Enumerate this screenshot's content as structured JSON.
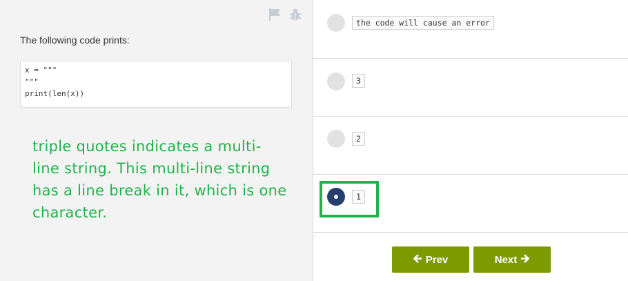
{
  "header": {
    "flag_icon": "flag-icon",
    "bug_icon": "bug-icon"
  },
  "question": {
    "prompt": "The following code prints:",
    "code_lines": [
      "x = \"\"\"",
      "\"\"\"",
      "print(len(x))"
    ]
  },
  "annotation": {
    "text": "triple quotes indicates a multi-line string. This multi-line string has a line break in it, which is one character.",
    "color": "#1fb34a"
  },
  "options": [
    {
      "label": "the code will cause an error",
      "selected": false
    },
    {
      "label": "3",
      "selected": false
    },
    {
      "label": "2",
      "selected": false
    },
    {
      "label": "1",
      "selected": true
    }
  ],
  "nav": {
    "prev_label": "Prev",
    "next_label": "Next",
    "button_color": "#7d9a00"
  },
  "colors": {
    "selected_radio": "#25406e",
    "unselected_radio": "#e2e2e2"
  }
}
